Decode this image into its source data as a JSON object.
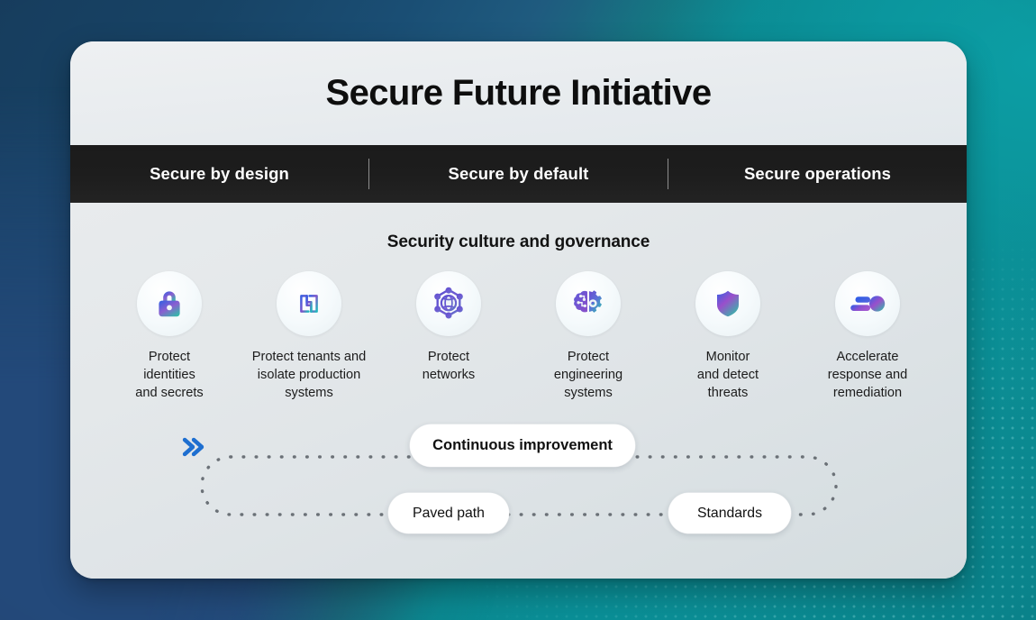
{
  "background": {
    "navy": "#23497a",
    "teal": "#0a8f97",
    "dark_navy": "#173d5e"
  },
  "card": {
    "title": "Secure Future Initiative",
    "nav": {
      "items": [
        {
          "label": "Secure by design"
        },
        {
          "label": "Secure by default"
        },
        {
          "label": "Secure operations"
        }
      ]
    },
    "section_heading": "Security culture and governance",
    "pillars": [
      {
        "icon": "lock-icon",
        "label": "Protect\nidentities\nand secrets"
      },
      {
        "icon": "tenant-isolation-icon",
        "label": "Protect tenants and\nisolate production\nsystems"
      },
      {
        "icon": "network-globe-icon",
        "label": "Protect\nnetworks"
      },
      {
        "icon": "brain-gear-icon",
        "label": "Protect\nengineering\nsystems"
      },
      {
        "icon": "shield-icon",
        "label": "Monitor\nand detect\nthreats"
      },
      {
        "icon": "accelerate-icon",
        "label": "Accelerate\nresponse and\nremediation"
      }
    ],
    "loop": {
      "continuous_label": "Continuous improvement",
      "paved_path_label": "Paved path",
      "standards_label": "Standards",
      "chevron_color": "#1e6fd0",
      "dot_color": "#6b7177"
    }
  }
}
